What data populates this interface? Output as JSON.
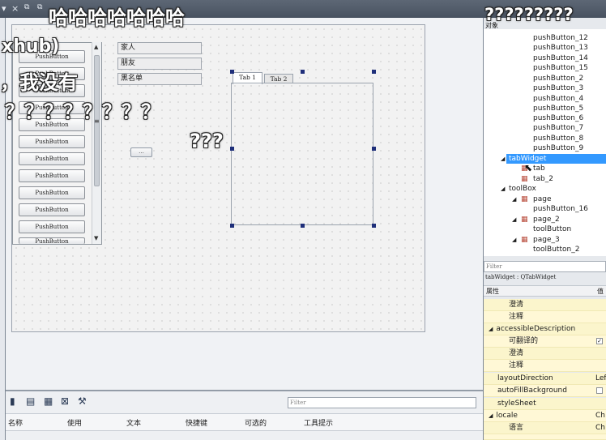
{
  "toolbar": {
    "close_glyph": "×"
  },
  "toolbox": {
    "items": [
      "PushButton",
      "PushButton",
      "PushButton",
      "PushButton",
      "PushButton",
      "PushButton",
      "PushButton",
      "PushButton",
      "PushButton",
      "PushButton",
      "PushButton",
      "PushButton"
    ]
  },
  "form": {
    "fields": [
      "家人",
      "朋友",
      "黑名单"
    ],
    "small_button": "...",
    "tabs": [
      "Tab 1",
      "Tab 2"
    ]
  },
  "action_editor": {
    "filter_placeholder": "Filter",
    "columns": [
      "名称",
      "使用",
      "文本",
      "快捷键",
      "可选的",
      "工具提示"
    ]
  },
  "object_inspector": {
    "header": "对象",
    "items": [
      {
        "label": "pushButton_12"
      },
      {
        "label": "pushButton_13"
      },
      {
        "label": "pushButton_14"
      },
      {
        "label": "pushButton_15"
      },
      {
        "label": "pushButton_2"
      },
      {
        "label": "pushButton_3"
      },
      {
        "label": "pushButton_4"
      },
      {
        "label": "pushButton_5"
      },
      {
        "label": "pushButton_6"
      },
      {
        "label": "pushButton_7"
      },
      {
        "label": "pushButton_8"
      },
      {
        "label": "pushButton_9"
      },
      {
        "label": "tabWidget"
      },
      {
        "label": "tab"
      },
      {
        "label": "tab_2"
      },
      {
        "label": "toolBox"
      },
      {
        "label": "page"
      },
      {
        "label": "pushButton_16"
      },
      {
        "label": "page_2"
      },
      {
        "label": "toolButton"
      },
      {
        "label": "page_3"
      },
      {
        "label": "toolButton_2"
      }
    ]
  },
  "property_editor": {
    "filter_placeholder": "Filter",
    "caption": "tabWidget : QTabWidget",
    "header_property": "属性",
    "header_value": "值",
    "rows": [
      {
        "name": "澄清",
        "value": ""
      },
      {
        "name": "注释",
        "value": ""
      },
      {
        "name": "accessibleDescription",
        "value": ""
      },
      {
        "name": "可翻译的",
        "value": "✓"
      },
      {
        "name": "澄清",
        "value": ""
      },
      {
        "name": "注释",
        "value": ""
      },
      {
        "name": "layoutDirection",
        "value": "Lef"
      },
      {
        "name": "autoFillBackground",
        "value": ""
      },
      {
        "name": "styleSheet",
        "value": ""
      },
      {
        "name": "locale",
        "value": "Ch"
      },
      {
        "name": "语言",
        "value": "Ch"
      }
    ]
  },
  "overlay": {
    "c1": "哈哈哈哈哈哈哈",
    "c2": "?????????",
    "c3": "xhub)",
    "c4": "，我没有",
    "c5": "？？？？？？？？",
    "c6": "???"
  }
}
